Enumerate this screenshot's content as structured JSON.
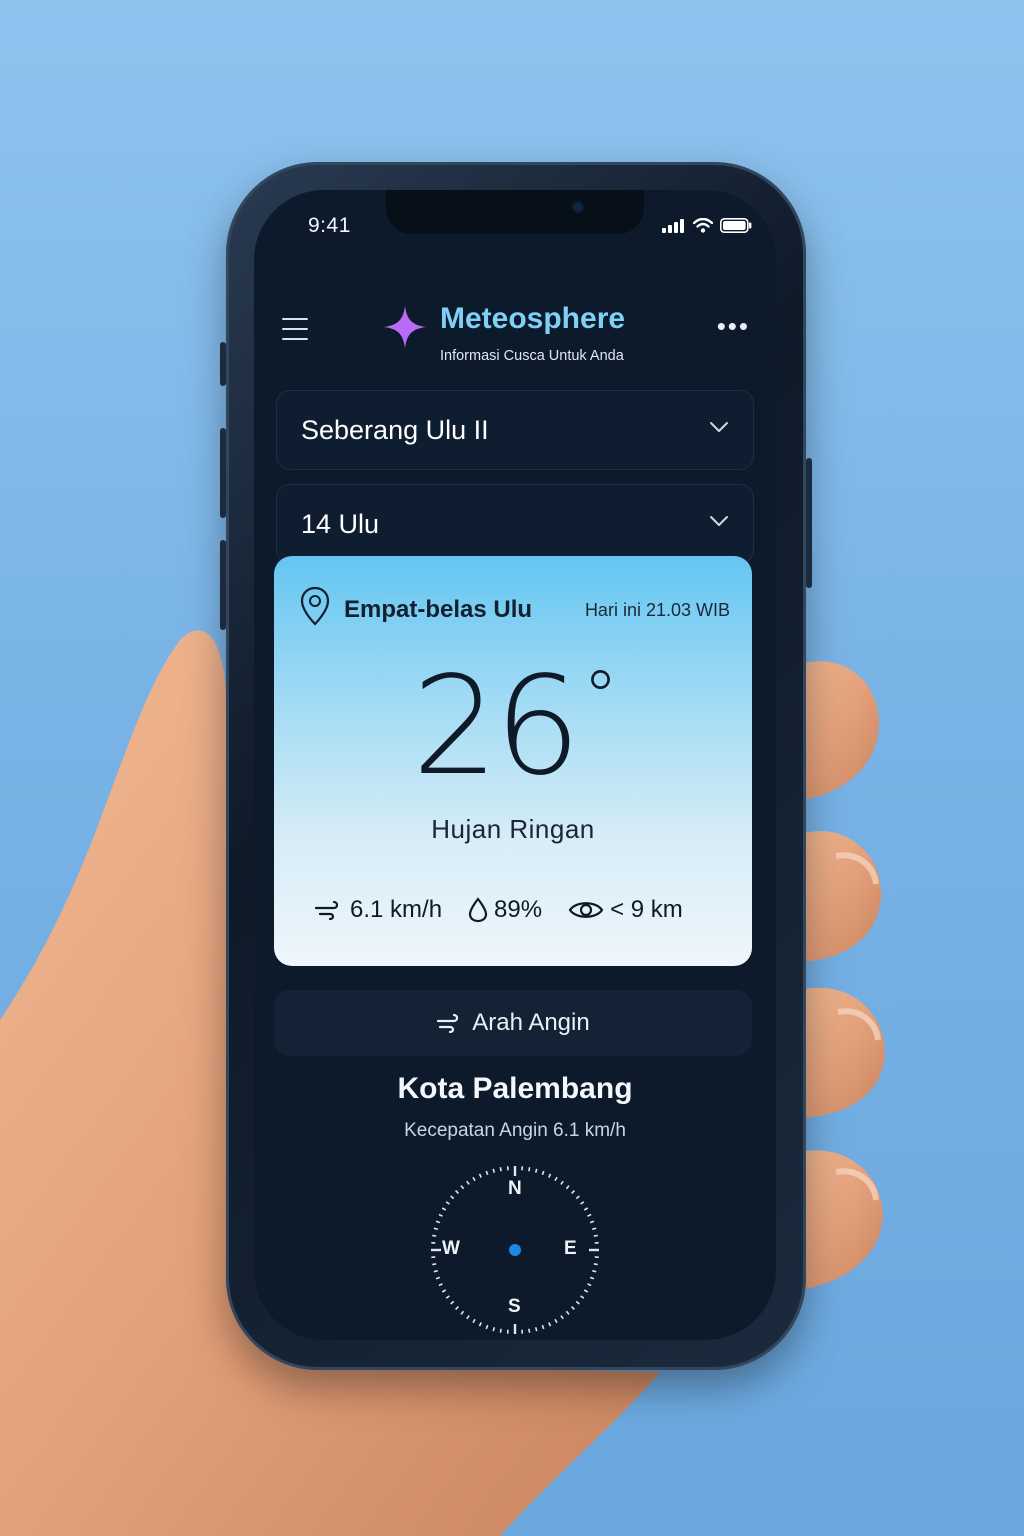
{
  "status": {
    "time": "9:41"
  },
  "header": {
    "title": "Meteosphere",
    "subtitle": "Informasi Cusca Untuk Anda",
    "menu_icon": "hamburger-icon",
    "more_icon": "more-icon"
  },
  "selects": {
    "district": "Seberang Ulu II",
    "subdistrict": "14 Ulu"
  },
  "weather": {
    "location": "Empat-belas Ulu",
    "date": "Hari ini 21.03 WIB",
    "temperature": "26",
    "degree": "°",
    "condition": "Hujan Ringan",
    "wind": "6.1 km/h",
    "humidity": "89%",
    "visibility": "< 9 km"
  },
  "wind_section": {
    "button_label": "Arah Angin",
    "city": "Kota Palembang",
    "speed_label": "Kecepatan Angin 6.1 km/h",
    "compass": {
      "n": "N",
      "e": "E",
      "s": "S",
      "w": "W"
    }
  },
  "colors": {
    "accent": "#7fd0f5",
    "star": "#b86cf5",
    "screen_bg": "#0c1a2b",
    "compass_center": "#1e88e5"
  }
}
